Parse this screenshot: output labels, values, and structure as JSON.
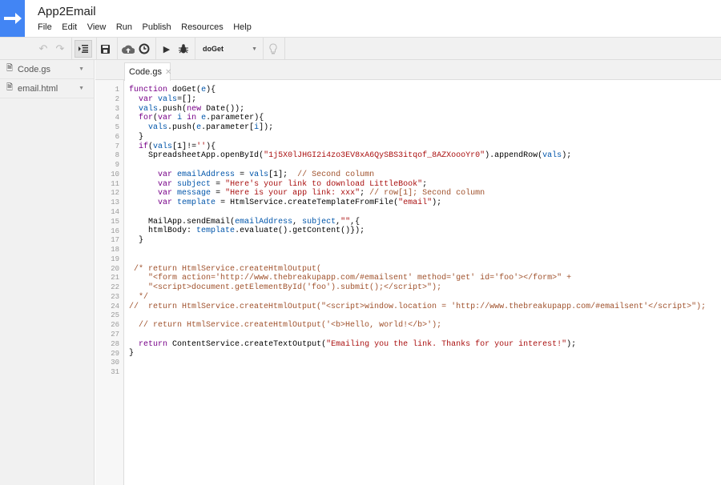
{
  "app": {
    "title": "App2Email",
    "menu": [
      "File",
      "Edit",
      "View",
      "Run",
      "Publish",
      "Resources",
      "Help"
    ]
  },
  "toolbar": {
    "function_select": "doGet",
    "icons": [
      "undo-icon",
      "redo-icon",
      "indent-icon",
      "save-icon",
      "cloud-upload-icon",
      "clock-trigger-icon",
      "run-icon",
      "debug-bug-icon",
      "lightbulb-icon"
    ]
  },
  "sidebar": {
    "files": [
      {
        "name": "Code.gs"
      },
      {
        "name": "email.html"
      }
    ]
  },
  "editor": {
    "tab": "Code.gs",
    "lines": [
      "function doGet(e){",
      "  var vals=[];",
      "  vals.push(new Date());",
      "  for(var i in e.parameter){",
      "    vals.push(e.parameter[i]);",
      "  }",
      "  if(vals[1]!=''){",
      "    SpreadsheetApp.openById(\"1j5X0lJHGI2i4zo3EV8xA6QySBS3itqof_8AZXoooYr0\").appendRow(vals);",
      "",
      "      var emailAddress = vals[1];  // Second column",
      "      var subject = \"Here's your link to download LittleBook\";",
      "      var message = \"Here is your app link: xxx\"; // row[1]; Second column",
      "      var template = HtmlService.createTemplateFromFile(\"email\");",
      "",
      "    MailApp.sendEmail(emailAddress, subject,\"\",{",
      "    htmlBody: template.evaluate().getContent()});",
      "  }",
      "",
      "",
      " /* return HtmlService.createHtmlOutput(",
      "    \"<form action='http://www.thebreakupapp.com/#emailsent' method='get' id='foo'></form>\" +",
      "    \"<script>document.getElementById('foo').submit();</script>\");",
      "  */",
      "//  return HtmlService.createHtmlOutput(\"<script>window.location = 'http://www.thebreakupapp.com/#emailsent'</script>\");",
      "",
      "  // return HtmlService.createHtmlOutput('<b>Hello, world!</b>');",
      "",
      "  return ContentService.createTextOutput(\"Emailing you the link. Thanks for your interest!\");",
      "}",
      "",
      ""
    ]
  }
}
